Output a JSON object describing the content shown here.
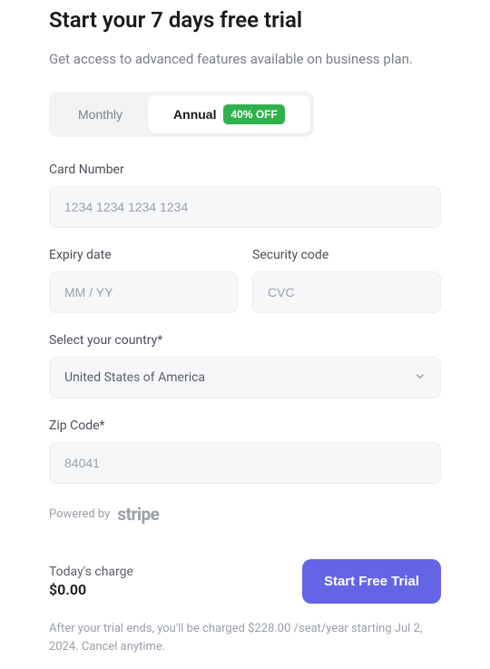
{
  "header": {
    "title": "Start your 7 days free trial",
    "subtitle": "Get access to advanced features available on business plan."
  },
  "billing_toggle": {
    "monthly_label": "Monthly",
    "annual_label": "Annual",
    "annual_badge": "40% OFF"
  },
  "card_number": {
    "label": "Card Number",
    "placeholder": "1234 1234 1234 1234"
  },
  "expiry": {
    "label": "Expiry date",
    "placeholder": "MM / YY"
  },
  "security_code": {
    "label": "Security code",
    "placeholder": "CVC"
  },
  "country": {
    "label": "Select your country*",
    "value": "United States of America"
  },
  "zip": {
    "label": "Zip Code*",
    "placeholder": "84041"
  },
  "powered_by": {
    "prefix": "Powered by",
    "brand": "stripe"
  },
  "footer": {
    "charge_label": "Today's charge",
    "charge_amount": "$0.00",
    "cta_label": "Start Free Trial",
    "disclaimer": "After your trial ends, you'll be charged $228.00 /seat/year starting Jul 2, 2024. Cancel anytime."
  }
}
